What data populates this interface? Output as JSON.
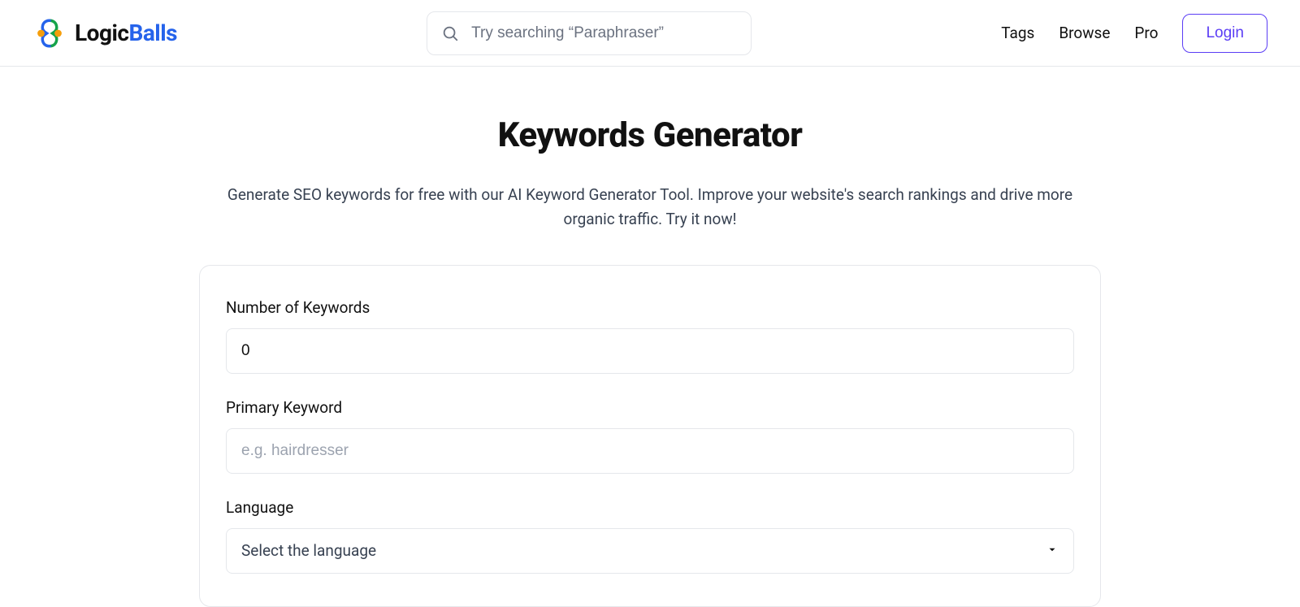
{
  "header": {
    "logo_part1": "Logic",
    "logo_part2": "Balls",
    "search_placeholder": "Try searching “Paraphraser”",
    "nav": {
      "tags": "Tags",
      "browse": "Browse",
      "pro": "Pro",
      "login": "Login"
    }
  },
  "page": {
    "title": "Keywords Generator",
    "subtitle": "Generate SEO keywords for free with our AI Keyword Generator Tool. Improve your website's search rankings and drive more organic traffic. Try it now!"
  },
  "form": {
    "count_label": "Number of Keywords",
    "count_value": "0",
    "primary_label": "Primary Keyword",
    "primary_placeholder": "e.g. hairdresser",
    "language_label": "Language",
    "language_selected": "Select the language"
  },
  "colors": {
    "accent": "#5b3df5",
    "brand_blue": "#2563eb",
    "border": "#e5e7eb"
  }
}
